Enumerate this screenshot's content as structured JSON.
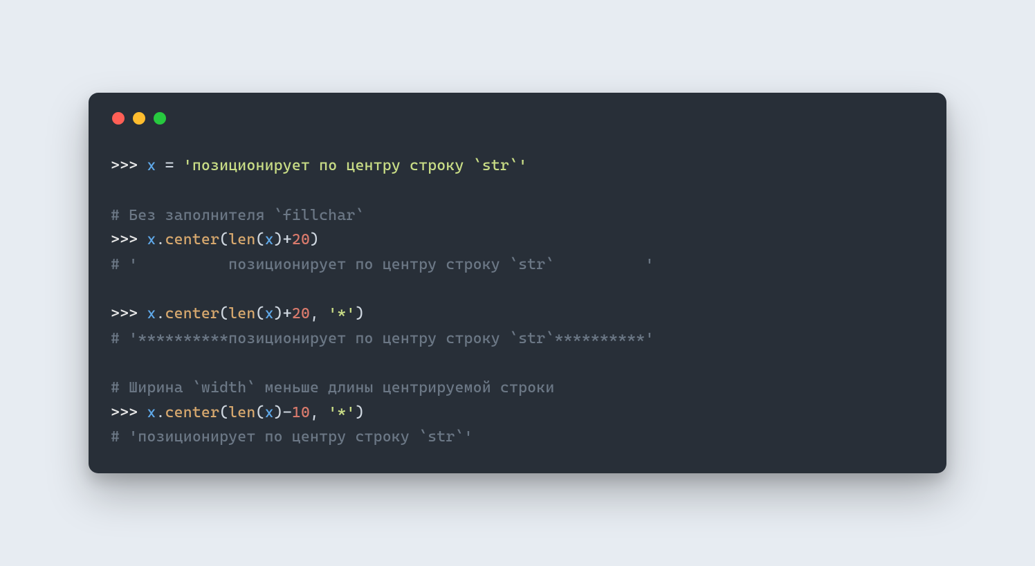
{
  "colors": {
    "page_bg": "#e7ecf2",
    "window_bg": "#282f38",
    "dot_red": "#ff5f56",
    "dot_yellow": "#ffbd2e",
    "dot_green": "#27c93f",
    "prompt": "#e6e6e6",
    "var": "#5fa8e8",
    "string": "#c9dd86",
    "comment": "#6b7785",
    "func": "#d7a86e",
    "num": "#d97a6c"
  },
  "tokens": {
    "prompt": ">>> ",
    "var_x": "x",
    "eq": " = ",
    "str_assign": "'позиционирует по центру строку `str`'",
    "comment_fillchar": "# Без заполнителя `fillchar`",
    "dot": ".",
    "fn_center": "center",
    "lparen": "(",
    "rparen": ")",
    "fn_len": "len",
    "plus": "+",
    "minus": "-",
    "num20": "20",
    "num10": "10",
    "comma_sp": ", ",
    "str_star": "'*'",
    "comment_out1": "# '          позиционирует по центру строку `str`          '",
    "comment_out2": "# '**********позиционирует по центру строку `str`**********'",
    "comment_width": "# Ширина `width` меньше длины центрируемой строки",
    "comment_out3": "# 'позиционирует по центру строку `str`'"
  }
}
